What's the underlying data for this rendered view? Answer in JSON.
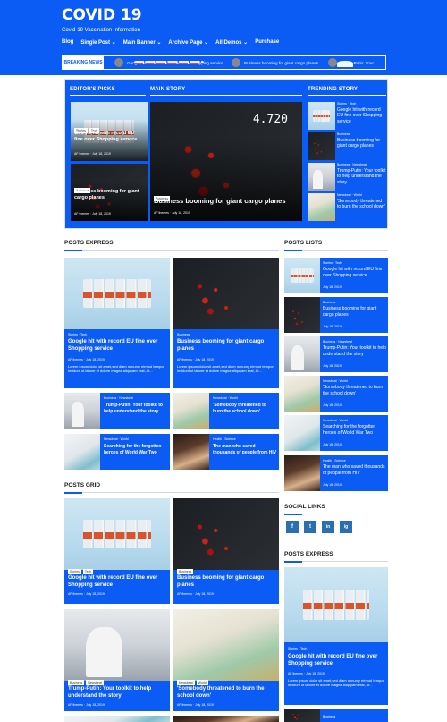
{
  "site": {
    "title": "COVID 19",
    "tagline": "Covid-19 Vaccination Information"
  },
  "nav": [
    "Blog",
    "Single Post ⌄",
    "Main Banner ⌄",
    "Archive Page ⌄",
    "All Demos ⌄",
    "Purchase"
  ],
  "ticker": {
    "label": "BREAKING NEWS",
    "items": [
      "Google hit with record EU fine over Shopping service",
      "Business booming for giant cargo planes",
      "Trump-Putin: Your"
    ]
  },
  "hero": {
    "editors_title": "EDITOR'S PICKS",
    "main_title": "MAIN STORY",
    "trending_title": "TRENDING STORY",
    "pick1": {
      "tags": [
        "Stories",
        "Tech"
      ],
      "title": "Google hit with record EU fine over Shopping service",
      "author": "AF themes",
      "date": "July 18, 2019"
    },
    "pick2": {
      "tags": [
        "Business"
      ],
      "title": "Business booming for giant cargo planes",
      "author": "AF themes",
      "date": "July 18, 2019"
    },
    "main": {
      "tags": [
        "Business"
      ],
      "title": "Business booming for giant cargo planes",
      "author": "AF themes",
      "date": "July 18, 2019"
    },
    "trending": [
      {
        "cat": "Stories · Tech",
        "title": "Google hit with record EU fine over Shopping service"
      },
      {
        "cat": "Business",
        "title": "Business booming for giant cargo planes"
      },
      {
        "cat": "Business · Newsbeat",
        "title": "Trump-Putin: Your toolkit to help understand the story"
      },
      {
        "cat": "Newsbeat · World",
        "title": "'Somebody threatened to burn the school down'"
      }
    ]
  },
  "posts_express": {
    "heading": "POSTS EXPRESS",
    "big": [
      {
        "cat": "Stories · Tech",
        "title": "Google hit with record EU fine over Shopping service",
        "author": "AF themes",
        "date": "July 18, 2019",
        "excerpt": "Lorem ipsum dolor sit amet,sed diam nonumy eirmod tempor invidunt ut labore et dolore magna aliquyam erat, At..."
      },
      {
        "cat": "Business",
        "title": "Business booming for giant cargo planes",
        "author": "AF themes",
        "date": "July 18, 2019",
        "excerpt": "Lorem ipsum dolor sit amet,sed diam nonumy eirmod tempor invidunt ut labore et dolore magna aliquyam erat, At..."
      }
    ],
    "small": [
      {
        "cat": "Business · Newsbeat",
        "title": "Trump-Putin: Your toolkit to help understand the story"
      },
      {
        "cat": "Newsbeat · World",
        "title": "'Somebody threatened to burn the school down'"
      },
      {
        "cat": "Newsbeat · World",
        "title": "Searching for the forgotten heroes of World War Two"
      },
      {
        "cat": "Health · Science",
        "title": "The man who saved thousands of people from HIV"
      }
    ]
  },
  "posts_lists": {
    "heading": "POSTS LISTS",
    "items": [
      {
        "cat": "Stories · Tech",
        "title": "Google hit with record EU fine over Shopping service",
        "date": "July 18, 2019"
      },
      {
        "cat": "Business",
        "title": "Business booming for giant cargo planes",
        "date": "July 18, 2019"
      },
      {
        "cat": "Business · Newsbeat",
        "title": "Trump-Putin: Your toolkit to help understand the story",
        "date": "July 18, 2019"
      },
      {
        "cat": "Newsbeat · World",
        "title": "'Somebody threatened to burn the school down'",
        "date": "July 18, 2019"
      },
      {
        "cat": "Newsbeat · World",
        "title": "Searching for the forgotten heroes of World War Two",
        "date": "July 18, 2019"
      },
      {
        "cat": "Health · Science",
        "title": "The man who saved thousands of people from HIV",
        "date": "July 18, 2019"
      }
    ]
  },
  "social": {
    "heading": "SOCIAL LINKS",
    "icons": [
      "f",
      "t",
      "in",
      "ig"
    ]
  },
  "posts_express2": {
    "heading": "POSTS EXPRESS",
    "cat": "Stories · Tech",
    "title": "Google hit with record EU fine over Shopping service",
    "author": "AF themes",
    "date": "July 18, 2019",
    "excerpt": "Lorem ipsum dolor sit amet,sed diam nonumy eirmod tempor invidunt ut labore et dolore magna aliquyam erat, At...",
    "next_cat": "Business"
  },
  "posts_grid": {
    "heading": "POSTS GRID",
    "items": [
      {
        "tags": [
          "Stories",
          "Tech"
        ],
        "title": "Google hit with record EU fine over Shopping service",
        "author": "AF themes",
        "date": "July 18, 2019"
      },
      {
        "tags": [
          "Business"
        ],
        "title": "Business booming for giant cargo planes",
        "author": "AF themes",
        "date": "July 18, 2019"
      },
      {
        "tags": [
          "Business",
          "Newsbeat"
        ],
        "title": "Trump-Putin: Your toolkit to help understand the story",
        "author": "AF themes",
        "date": "July 18, 2019"
      },
      {
        "tags": [
          "Newsbeat",
          "World"
        ],
        "title": "'Somebody threatened to burn the school down'",
        "author": "AF themes",
        "date": "July 18, 2019"
      }
    ]
  }
}
